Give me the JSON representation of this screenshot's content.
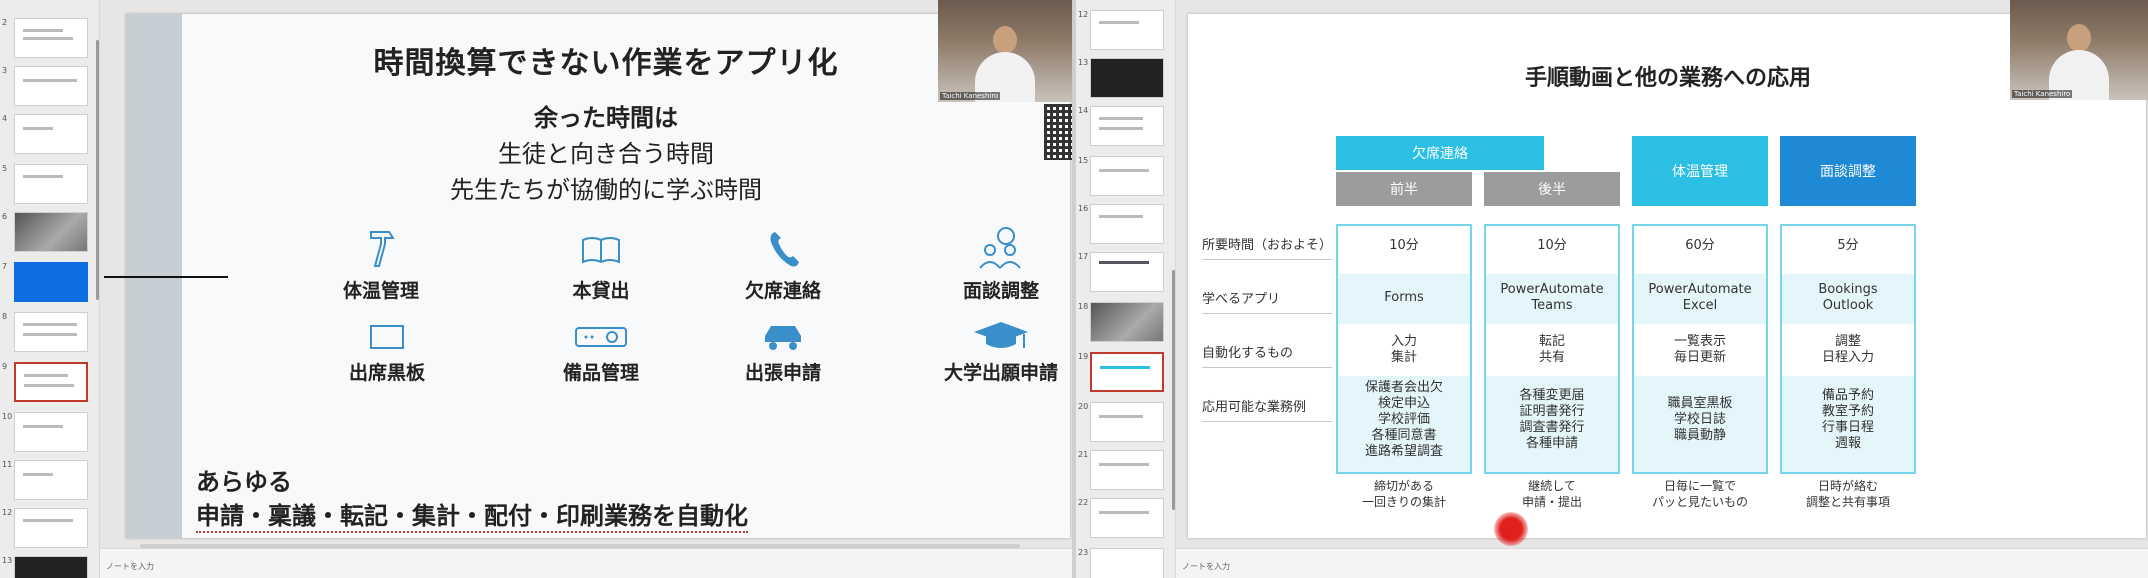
{
  "left": {
    "thumb_numbers": [
      "2",
      "3",
      "4",
      "5",
      "6",
      "7",
      "8",
      "9",
      "10",
      "11",
      "12",
      "13"
    ],
    "slide": {
      "title": "時間換算できない作業をアプリ化",
      "subtitle_bold": "余った時間は",
      "subtitle_line2": "生徒と向き合う時間",
      "subtitle_line3": "先生たちが協働的に学ぶ時間",
      "items": [
        {
          "label": "体温管理",
          "icon": "thermometer-icon"
        },
        {
          "label": "本貸出",
          "icon": "book-icon"
        },
        {
          "label": "欠席連絡",
          "icon": "phone-icon"
        },
        {
          "label": "面談調整",
          "icon": "meeting-icon"
        },
        {
          "label": "出席黒板",
          "icon": "blackboard-icon"
        },
        {
          "label": "備品管理",
          "icon": "projector-icon"
        },
        {
          "label": "出張申請",
          "icon": "car-icon"
        },
        {
          "label": "大学出願申請",
          "icon": "graduation-cap-icon"
        }
      ],
      "footer_line1": "あらゆる",
      "footer_line2": "申請・稟議・転記・集計・配付・印刷業務を自動化"
    },
    "notes_placeholder": "ノートを入力",
    "webcam_label": "Taichi Kaneshiro"
  },
  "right": {
    "thumb_numbers": [
      "12",
      "13",
      "14",
      "15",
      "16",
      "17",
      "18",
      "19",
      "20",
      "21",
      "22",
      "23"
    ],
    "slide": {
      "title": "手順動画と他の業務への応用",
      "headers": {
        "absence": "欠席連絡",
        "first_half": "前半",
        "second_half": "後半",
        "temperature": "体温管理",
        "interview": "面談調整"
      },
      "row_labels": [
        "所要時間（おおよそ）",
        "学べるアプリ",
        "自動化するもの",
        "応用可能な業務例"
      ],
      "columns": [
        {
          "time": "10分",
          "apps": "Forms",
          "auto": [
            "入力",
            "集計"
          ],
          "examples": [
            "保護者会出欠",
            "検定申込",
            "学校評価",
            "各種同意書",
            "進路希望調査"
          ],
          "caption": [
            "締切がある",
            "一回きりの集計"
          ]
        },
        {
          "time": "10分",
          "apps": "PowerAutomate Teams",
          "auto": [
            "転記",
            "共有"
          ],
          "examples": [
            "各種変更届",
            "証明書発行",
            "調査書発行",
            "各種申請"
          ],
          "caption": [
            "継続して",
            "申請・提出"
          ]
        },
        {
          "time": "60分",
          "apps": "PowerAutomate Excel",
          "auto": [
            "一覧表示",
            "毎日更新"
          ],
          "examples": [
            "職員室黒板",
            "学校日誌",
            "職員動静"
          ],
          "caption": [
            "日毎に一覧で",
            "パッと見たいもの"
          ]
        },
        {
          "time": "5分",
          "apps": "Bookings Outlook",
          "auto": [
            "調整",
            "日程入力"
          ],
          "examples": [
            "備品予約",
            "教室予約",
            "行事日程",
            "週報"
          ],
          "caption": [
            "日時が絡む",
            "調整と共有事項"
          ]
        }
      ]
    },
    "notes_placeholder": "ノートを入力",
    "webcam_label": "Taichi Kaneshiro"
  },
  "colors": {
    "cyan": "#2bbfe3",
    "blue": "#1e8ad6",
    "gray": "#9c9c9c",
    "accent_red": "#c0392b"
  }
}
